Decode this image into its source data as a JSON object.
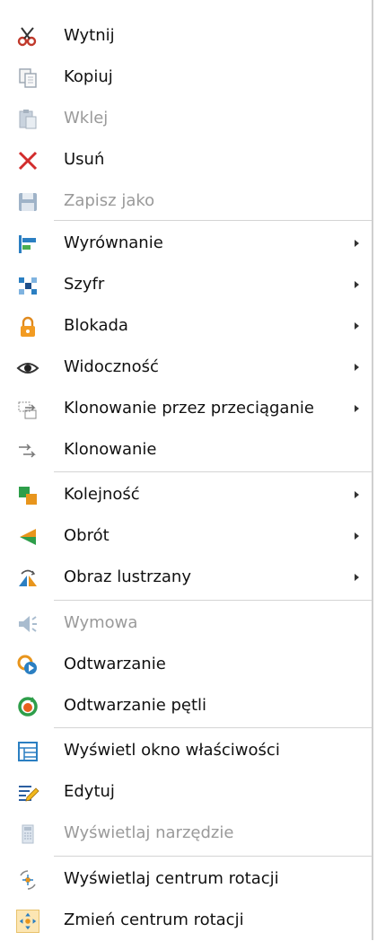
{
  "menu": {
    "items": [
      {
        "label": "Wytnij",
        "icon": "scissors-icon",
        "enabled": true
      },
      {
        "label": "Kopiuj",
        "icon": "copy-icon",
        "enabled": true
      },
      {
        "label": "Wklej",
        "icon": "paste-icon",
        "enabled": false
      },
      {
        "label": "Usuń",
        "icon": "delete-x-icon",
        "enabled": true
      },
      {
        "label": "Zapisz jako",
        "icon": "floppy-icon",
        "enabled": false
      },
      {
        "label": "Wyrównanie",
        "icon": "align-icon",
        "enabled": true,
        "submenu": true
      },
      {
        "label": "Szyfr",
        "icon": "cipher-icon",
        "enabled": true,
        "submenu": true
      },
      {
        "label": "Blokada",
        "icon": "lock-icon",
        "enabled": true,
        "submenu": true
      },
      {
        "label": "Widoczność",
        "icon": "eye-icon",
        "enabled": true,
        "submenu": true
      },
      {
        "label": "Klonowanie przez przeciąganie",
        "icon": "drag-clone-icon",
        "enabled": true,
        "submenu": true
      },
      {
        "label": "Klonowanie",
        "icon": "clone-icon",
        "enabled": true
      },
      {
        "label": "Kolejność",
        "icon": "order-icon",
        "enabled": true,
        "submenu": true
      },
      {
        "label": "Obrót",
        "icon": "rotate-icon",
        "enabled": true,
        "submenu": true
      },
      {
        "label": "Obraz lustrzany",
        "icon": "mirror-icon",
        "enabled": true,
        "submenu": true
      },
      {
        "label": "Wymowa",
        "icon": "speaker-icon",
        "enabled": false
      },
      {
        "label": "Odtwarzanie",
        "icon": "play-icon",
        "enabled": true
      },
      {
        "label": "Odtwarzanie pętli",
        "icon": "loop-icon",
        "enabled": true
      },
      {
        "label": "Wyświetl okno właściwości",
        "icon": "properties-icon",
        "enabled": true
      },
      {
        "label": "Edytuj",
        "icon": "edit-icon",
        "enabled": true
      },
      {
        "label": "Wyświetlaj narzędzie",
        "icon": "tool-icon",
        "enabled": false
      },
      {
        "label": "Wyświetlaj centrum rotacji",
        "icon": "rotation-center-icon",
        "enabled": true
      },
      {
        "label": "Zmień centrum rotacji",
        "icon": "change-rotation-center-icon",
        "enabled": true
      }
    ]
  }
}
